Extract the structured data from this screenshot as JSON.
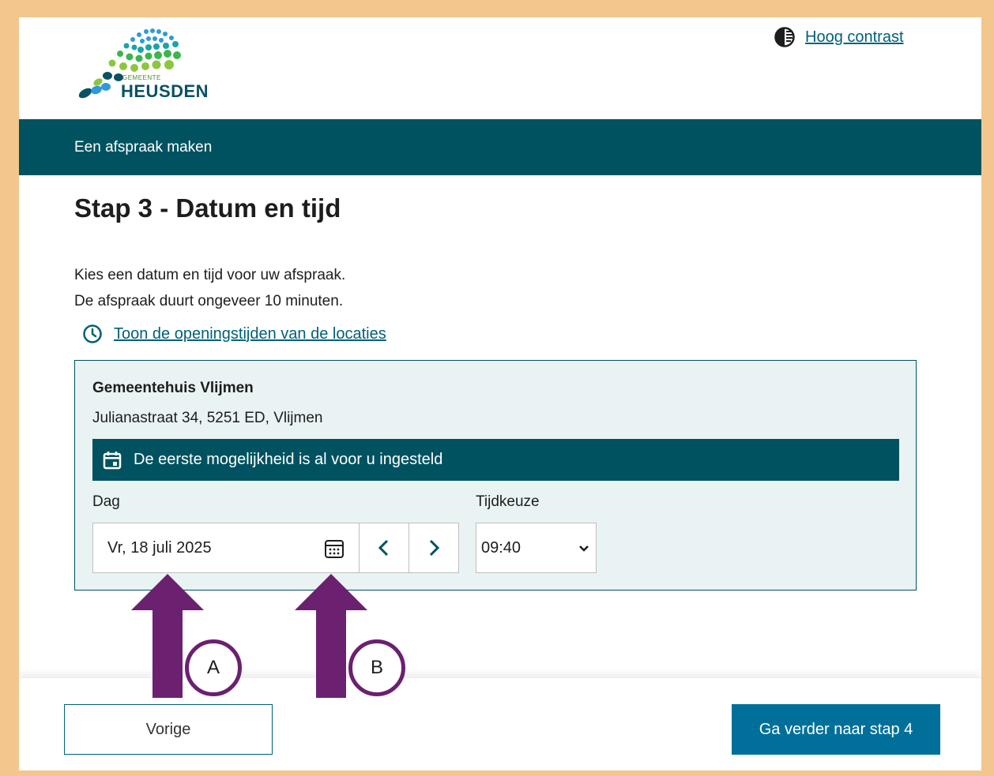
{
  "header": {
    "logo_small": "GEMEENTE",
    "logo_name": "HEUSDEN",
    "contrast_link": "Hoog contrast"
  },
  "nav": {
    "title": "Een afspraak maken"
  },
  "page": {
    "title": "Stap 3 - Datum en tijd",
    "intro_line1": "Kies een datum en tijd voor uw afspraak.",
    "intro_line2": "De afspraak duurt ongeveer 10 minuten.",
    "hours_link": "Toon de openingstijden van de locaties"
  },
  "location": {
    "name": "Gemeentehuis Vlijmen",
    "address": "Julianastraat 34, 5251 ED, Vlijmen",
    "notice": "De eerste mogelijkheid is al voor u ingesteld",
    "day_label": "Dag",
    "day_value": "Vr, 18 juli 2025",
    "time_label": "Tijdkeuze",
    "time_value": "09:40"
  },
  "footer": {
    "prev_label": "Vorige",
    "next_label": "Ga verder naar stap 4"
  },
  "annotations": {
    "marker_a": "A",
    "marker_b": "B",
    "arrow_color": "#6b2070"
  },
  "colors": {
    "brand_dark": "#005260",
    "link": "#00607a",
    "primary_button": "#00709a",
    "frame": "#f3c68e"
  }
}
